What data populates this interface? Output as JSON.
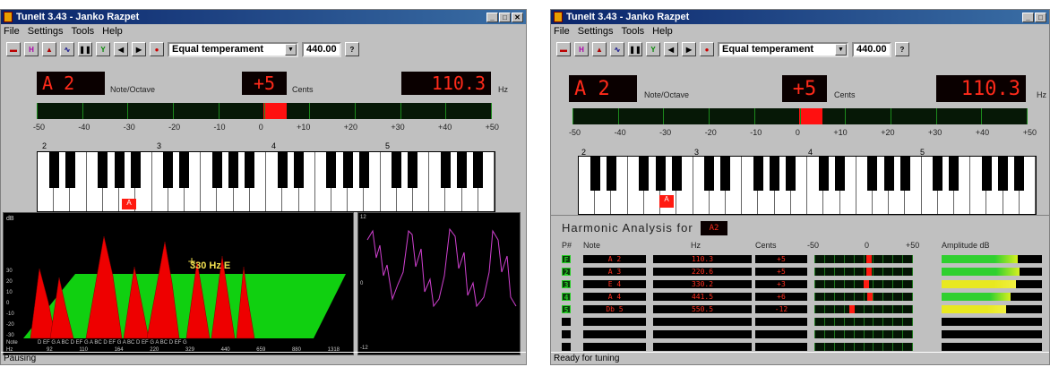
{
  "left": {
    "title": "TuneIt 3.43  -  Janko Razpet",
    "menu": [
      "File",
      "Settings",
      "Tools",
      "Help"
    ],
    "temperament": "Equal temperament",
    "ref_freq": "440.00",
    "note": "A 2",
    "note_label": "Note/Octave",
    "cents": "+5",
    "cents_label": "Cents",
    "freq": "110.3",
    "hz_label": "Hz",
    "status": "Pausing",
    "spectrum_annotation": "330 Hz E",
    "marker": "A"
  },
  "right": {
    "title": "TuneIt 3.43  -  Janko Razpet",
    "menu": [
      "File",
      "Settings",
      "Tools",
      "Help"
    ],
    "temperament": "Equal temperament",
    "ref_freq": "440.00",
    "note": "A 2",
    "note_label": "Note/Octave",
    "cents": "+5",
    "cents_label": "Cents",
    "freq": "110.3",
    "hz_label": "Hz",
    "status": "Ready for tuning",
    "marker": "A",
    "ha_title": "Harmonic Analysis for",
    "ha_note": "A2",
    "ha_headers": {
      "pn": "P#",
      "note": "Note",
      "hz": "Hz",
      "cents": "Cents",
      "m50": "-50",
      "zero": "0",
      "p50": "+50",
      "amp": "Amplitude dB"
    },
    "rows": [
      {
        "p": "F",
        "note": "A 2",
        "hz": "110.3",
        "cents": "+5",
        "dev": 5,
        "amp": 0.76
      },
      {
        "p": "2",
        "note": "A 3",
        "hz": "220.6",
        "cents": "+5",
        "dev": 5,
        "amp": 0.78
      },
      {
        "p": "3",
        "note": "E 4",
        "hz": "330.2",
        "cents": "+3",
        "dev": 3,
        "amp": 0.74
      },
      {
        "p": "4",
        "note": "A 4",
        "hz": "441.5",
        "cents": "+6",
        "dev": 6,
        "amp": 0.69
      },
      {
        "p": "5",
        "note": "Db 5",
        "hz": "550.5",
        "cents": "-12",
        "dev": -12,
        "amp": 0.64
      }
    ]
  },
  "scale": [
    "-50",
    "-40",
    "-30",
    "-20",
    "-10",
    "0",
    "+10",
    "+20",
    "+30",
    "+40",
    "+50"
  ],
  "octaves": [
    "2",
    "3",
    "4",
    "5"
  ],
  "spectrum_y": [
    "30",
    "20",
    "10",
    "0",
    "-10",
    "-20",
    "-30"
  ],
  "spectrum_axis_top": "dB",
  "spectrum_axis_bottom": "Note",
  "spectrum_axis_hz": "Hz",
  "spectrum_x": "D EF G A BC D EF G A BC D EF G A BC D EF G A BC D EF G",
  "spectrum_hz": "92 110 164 220 329 440 659 880 1318",
  "wave_y": [
    "12",
    "0",
    "-12"
  ]
}
